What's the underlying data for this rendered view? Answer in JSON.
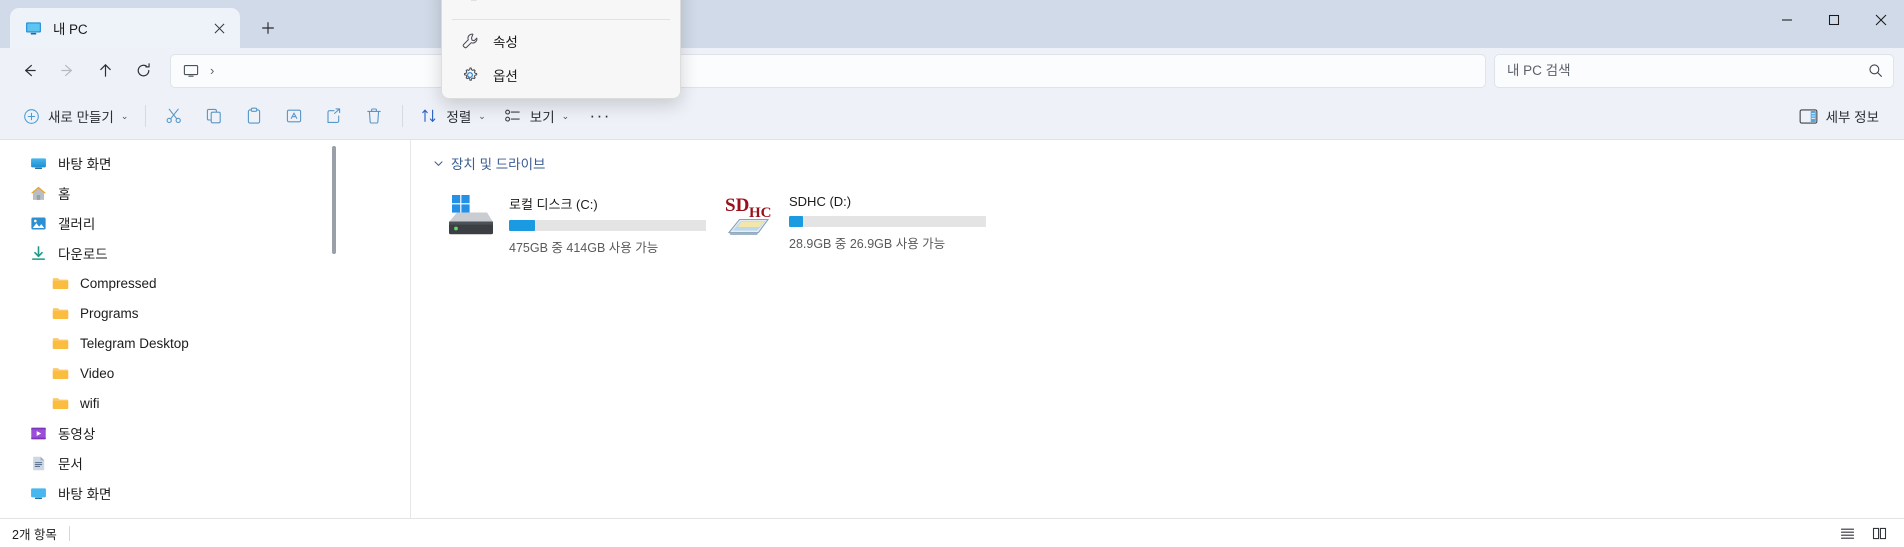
{
  "window": {
    "tab_title": "내 PC",
    "tab_icon": "this-pc-icon",
    "new_tab_label": "+",
    "minimize_label": "—",
    "maximize_label": "□",
    "close_label": "✕",
    "accent_color": "#1a9ae0",
    "titlebar_color": "#d0dae8",
    "chrome_color": "#eef2f8"
  },
  "navbar": {
    "back_label": "←",
    "forward_label": "→",
    "up_label": "↑",
    "refresh_label": "⟳",
    "breadcrumb_icon": "this-pc-icon",
    "breadcrumb_separator": "›",
    "breadcrumb_text": ""
  },
  "search": {
    "placeholder": "내 PC 검색",
    "value": "",
    "icon": "search-icon"
  },
  "toolbar": {
    "new_label": "새로 만들기",
    "new_chevron": "⌄",
    "cut_icon": "scissors-icon",
    "copy_icon": "copy-icon",
    "paste_icon": "clipboard-icon",
    "rename_icon": "rename-icon",
    "share_icon": "share-icon",
    "delete_icon": "trash-icon",
    "sort_label": "정렬",
    "sort_chevron": "⌄",
    "view_label": "보기",
    "view_chevron": "⌄",
    "more_label": "···",
    "details_label": "세부 정보",
    "details_icon": "details-pane-icon"
  },
  "context_menu": {
    "items": [
      {
        "label": "",
        "icon": "partially-cut-icon",
        "cut_off": true
      },
      {
        "label": "속성",
        "icon": "wrench-icon",
        "cut_off": false
      },
      {
        "label": "옵션",
        "icon": "gear-icon",
        "cut_off": false
      }
    ]
  },
  "sidebar": {
    "items": [
      {
        "label": "바탕 화면",
        "icon": "desktop-icon",
        "indent": 0
      },
      {
        "label": "홈",
        "icon": "home-icon",
        "indent": 0
      },
      {
        "label": "갤러리",
        "icon": "gallery-icon",
        "indent": 0
      },
      {
        "label": "다운로드",
        "icon": "download-icon",
        "indent": 0
      },
      {
        "label": "Compressed",
        "icon": "folder-icon",
        "indent": 1
      },
      {
        "label": "Programs",
        "icon": "folder-icon",
        "indent": 1
      },
      {
        "label": "Telegram Desktop",
        "icon": "folder-icon",
        "indent": 1
      },
      {
        "label": "Video",
        "icon": "folder-icon",
        "indent": 1
      },
      {
        "label": "wifi",
        "icon": "folder-icon",
        "indent": 1
      },
      {
        "label": "동영상",
        "icon": "videos-icon",
        "indent": 0
      },
      {
        "label": "문서",
        "icon": "documents-icon",
        "indent": 0
      },
      {
        "label": "바탕 화면",
        "icon": "desktop-icon",
        "indent": 0
      }
    ]
  },
  "content": {
    "group_label": "장치 및 드라이브",
    "group_chevron": "⌄",
    "drives": [
      {
        "name": "로컬 디스크 (C:)",
        "icon": "hard-drive-windows-icon",
        "capacity_text": "475GB 중 414GB 사용 가능",
        "total_gb": 475,
        "free_gb": 414,
        "used_percent": 13
      },
      {
        "name": "SDHC (D:)",
        "icon": "sd-card-icon",
        "icon_text_primary": "SD",
        "icon_text_secondary": "HC",
        "capacity_text": "28.9GB 중 26.9GB 사용 가능",
        "total_gb": 28.9,
        "free_gb": 26.9,
        "used_percent": 7
      }
    ]
  },
  "statusbar": {
    "item_count_text": "2개 항목",
    "list_view_icon": "list-view-icon",
    "grid_view_icon": "grid-view-icon"
  }
}
